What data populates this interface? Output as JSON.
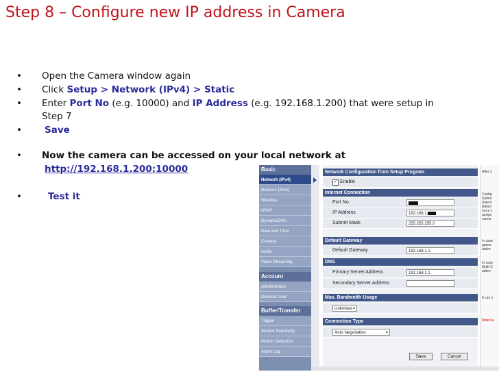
{
  "title": "Step 8 – Configure new IP address in Camera",
  "bullet_char": "•",
  "bullets": {
    "b1": "Open the Camera window again",
    "b2_pre": "Click ",
    "b2_hl": "Setup > Network (IPv4) > Static",
    "b3_pre": "Enter ",
    "b3_hl1": "Port No",
    "b3_mid": " (e.g. 10000) and ",
    "b3_hl2": "IP Address",
    "b3_post": " (e.g. 192.168.1.200) that were setup in",
    "b3_line2": "Step 7",
    "b4": "Save",
    "b5": "Now the camera can be accessed on your local network at",
    "b5_link": "http://192.168.1.200:10000",
    "b6": "Test it"
  },
  "camera": {
    "sidebar": {
      "basic_head": "Basic",
      "basic_items": [
        "Network (IPv4)",
        "Network (IPv6)",
        "Wireless",
        "UPnP",
        "DynamicDNS",
        "Date and Time",
        "Camera",
        "Audio",
        "Video Streaming"
      ],
      "account_head": "Account",
      "account_items": [
        "Administrator",
        "General User"
      ],
      "buffer_head": "Buffer/Transfer",
      "buffer_items": [
        "Trigger",
        "Sensor Sensitivity",
        "Motion Detection",
        "Alarm Log"
      ]
    },
    "sections": {
      "net_config": "Network Configuration from Setup Program",
      "enable": "Enable",
      "internet": "Internet Connection",
      "port_no": "Port No.",
      "ip_address": "IP Address",
      "subnet_mask": "Subnet Mask",
      "subnet_value": "255.255.255.0",
      "ip_value": "192.168.1.",
      "default_gw_head": "Default Gateway",
      "default_gw": "Default Gateway",
      "gw_value": "192.168.1.1",
      "dns_head": "DNS",
      "primary_dns": "Primary Server Address",
      "primary_value": "192.168.1.1",
      "secondary_dns": "Secondary Server Address",
      "bandwidth_head": "Max. Bandwidth Usage",
      "bandwidth_value": "Unlimited",
      "conn_type_head": "Connection Type",
      "conn_value": "Auto Negotiation",
      "save": "Save",
      "cancel": "Cancel"
    },
    "right_notes": {
      "n1": "After s",
      "n2": "Config",
      "n3": "Subne",
      "n4": "(Intern",
      "n5": "Admin",
      "n6": "more c",
      "n7": "assign",
      "n8": "camer",
      "n9": "In case",
      "n10": "gatew",
      "n11": "addre",
      "n12": "In case",
      "n13": "Multi-C",
      "n14": "addre",
      "n15": "It can s",
      "n16": "Note:Le"
    }
  }
}
